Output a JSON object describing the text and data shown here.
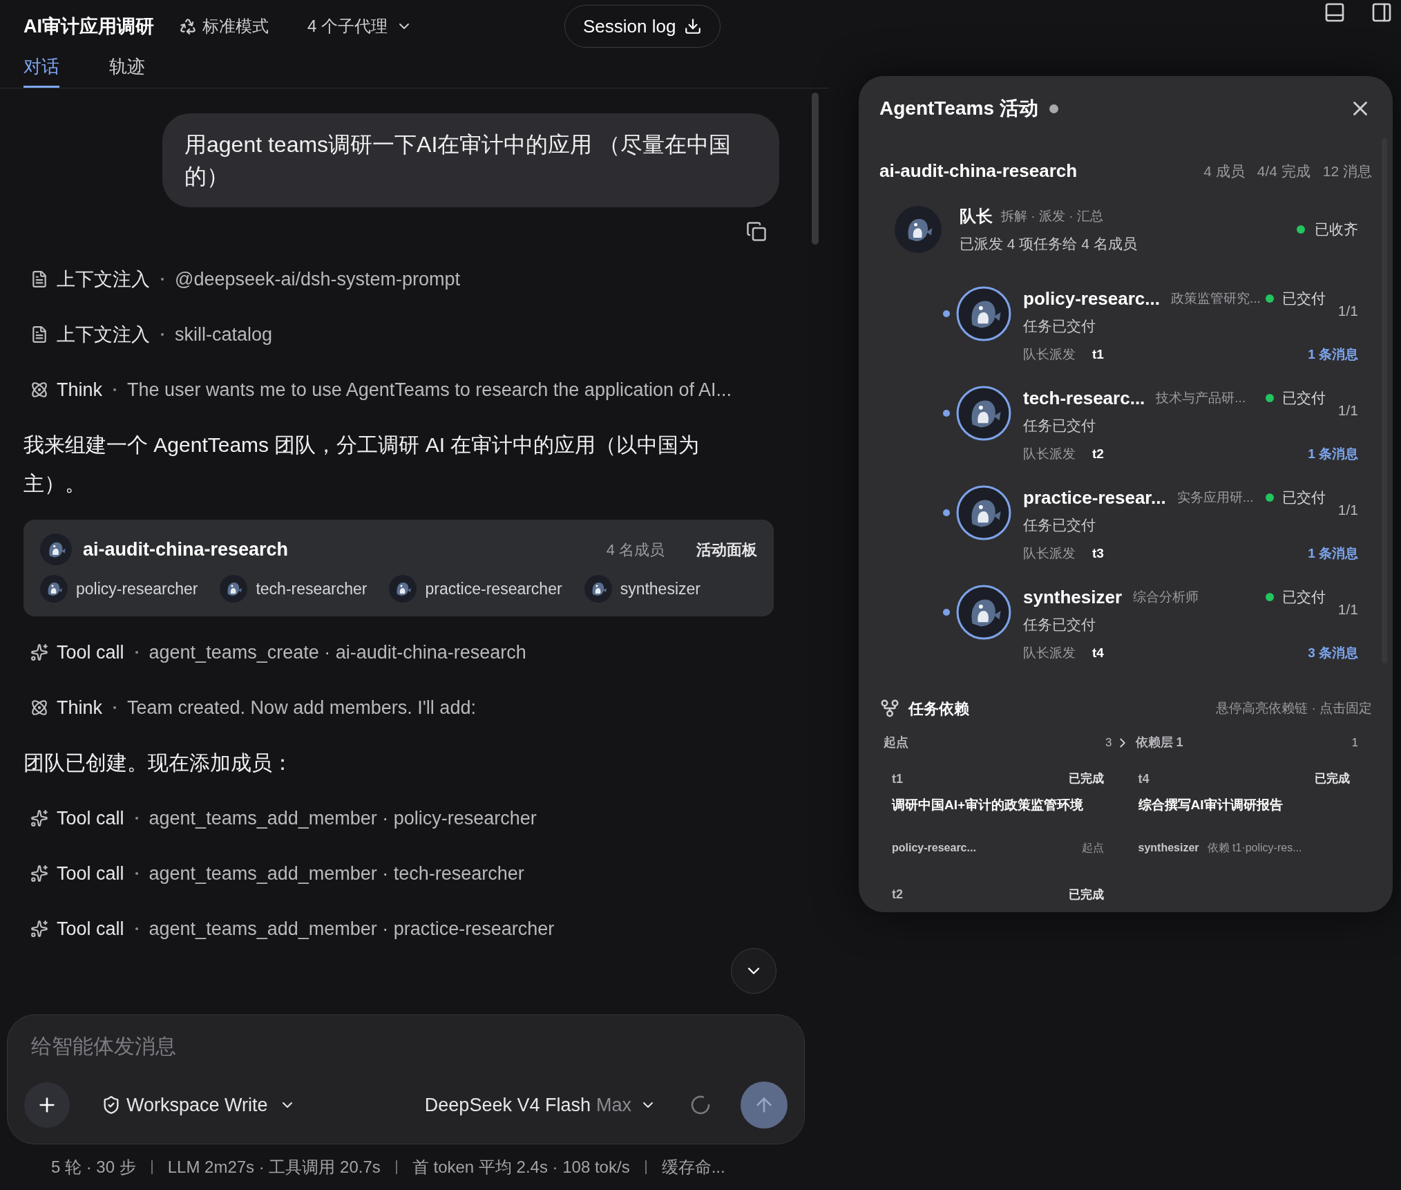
{
  "header": {
    "title": "AI审计应用调研",
    "mode": "标准模式",
    "subagents": "4 个子代理",
    "session_log": "Session log"
  },
  "tabs": [
    {
      "label": "对话",
      "selected": true
    },
    {
      "label": "轨迹",
      "selected": false
    }
  ],
  "user_message": "用agent teams调研一下AI在审计中的应用 （尽量在中国的）",
  "transcript": [
    {
      "kind": "context",
      "label": "上下文注入",
      "detail": "@deepseek-ai/dsh-system-prompt"
    },
    {
      "kind": "context",
      "label": "上下文注入",
      "detail": "skill-catalog"
    },
    {
      "kind": "think",
      "label": "Think",
      "detail": "The user wants me to use AgentTeams to research the application of AI..."
    },
    {
      "kind": "text",
      "text": "我来组建一个 AgentTeams 团队，分工调研 AI 在审计中的应用（以中国为主）。"
    },
    {
      "kind": "team",
      "name": "ai-audit-china-research",
      "count": "4 名成员",
      "action": "活动面板",
      "members": [
        "policy-researcher",
        "tech-researcher",
        "practice-researcher",
        "synthesizer"
      ]
    },
    {
      "kind": "tool",
      "label": "Tool call",
      "detail": "agent_teams_create · ai-audit-china-research"
    },
    {
      "kind": "think",
      "label": "Think",
      "detail": "Team created. Now add members. I'll add:"
    },
    {
      "kind": "text",
      "text": "团队已创建。现在添加成员："
    },
    {
      "kind": "tool",
      "label": "Tool call",
      "detail": "agent_teams_add_member · policy-researcher"
    },
    {
      "kind": "tool",
      "label": "Tool call",
      "detail": "agent_teams_add_member · tech-researcher"
    },
    {
      "kind": "tool",
      "label": "Tool call",
      "detail": "agent_teams_add_member · practice-researcher"
    }
  ],
  "composer": {
    "placeholder": "给智能体发消息",
    "permission": "Workspace Write",
    "model": "DeepSeek V4 Flash",
    "effort": "Max"
  },
  "stats": [
    "5 轮 · 30 步",
    "LLM 2m27s · 工具调用 20.7s",
    "首 token 平均 2.4s · 108 tok/s",
    "缓存命..."
  ],
  "panel": {
    "title": "AgentTeams 活动",
    "team": "ai-audit-china-research",
    "team_stats": [
      "4 成员",
      "4/4 完成",
      "12 消息"
    ],
    "leader": {
      "name": "队长",
      "role": "拆解 · 派发 · 汇总",
      "summary": "已派发 4 项任务给 4 名成员",
      "status": "已收齐",
      "color": "#22c55e"
    },
    "members": [
      {
        "name": "policy-researc...",
        "role": "政策监管研究...",
        "status": "已交付",
        "color": "#22c55e",
        "progress": "1/1",
        "summary": "任务已交付",
        "dispatch": "队长派发",
        "task": "t1",
        "messages": "1 条消息"
      },
      {
        "name": "tech-researc...",
        "role": "技术与产品研...",
        "status": "已交付",
        "color": "#22c55e",
        "progress": "1/1",
        "summary": "任务已交付",
        "dispatch": "队长派发",
        "task": "t2",
        "messages": "1 条消息"
      },
      {
        "name": "practice-resear...",
        "role": "实务应用研...",
        "status": "已交付",
        "color": "#22c55e",
        "progress": "1/1",
        "summary": "任务已交付",
        "dispatch": "队长派发",
        "task": "t3",
        "messages": "1 条消息"
      },
      {
        "name": "synthesizer",
        "role": "综合分析师",
        "status": "已交付",
        "color": "#22c55e",
        "progress": "1/1",
        "summary": "任务已交付",
        "dispatch": "队长派发",
        "task": "t4",
        "messages": "3 条消息"
      }
    ],
    "deps": {
      "title": "任务依赖",
      "hint": "悬停高亮依赖链 · 点击固定",
      "columns": [
        {
          "label": "起点",
          "count": "3",
          "tasks": [
            {
              "id": "t1",
              "status": "已完成",
              "title": "调研中国AI+审计的政策监管环境",
              "owner": "policy-researc...",
              "dep": "起点"
            },
            {
              "id": "t2",
              "status": "已完成"
            }
          ]
        },
        {
          "label": "依赖层 1",
          "count": "1",
          "tasks": [
            {
              "id": "t4",
              "status": "已完成",
              "title": "综合撰写AI审计调研报告",
              "owner": "synthesizer",
              "dep": "依赖 t1·policy-res..."
            }
          ]
        }
      ]
    }
  }
}
